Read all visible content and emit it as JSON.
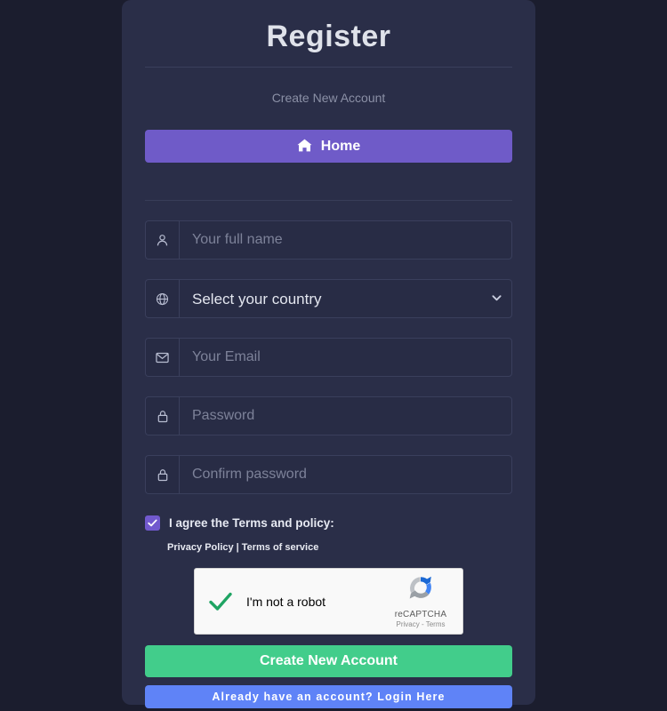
{
  "card": {
    "title": "Register",
    "subtitle": "Create New Account"
  },
  "home_button": {
    "label": "Home",
    "icon": "home-icon",
    "color": "#6f5bc8"
  },
  "fields": [
    {
      "name": "full-name",
      "icon": "person-icon",
      "placeholder": "Your full name",
      "value": ""
    },
    {
      "name": "country",
      "icon": "globe-icon",
      "selected": "Select your country",
      "chevron": "chevron-down-icon"
    },
    {
      "name": "email",
      "icon": "envelope-icon",
      "placeholder": "Your Email",
      "value": ""
    },
    {
      "name": "password",
      "icon": "lock-icon",
      "placeholder": "Password",
      "value": ""
    },
    {
      "name": "confirm-password",
      "icon": "lock-icon",
      "placeholder": "Confirm password",
      "value": ""
    }
  ],
  "terms": {
    "checked": true,
    "checkbox_icon": "checkmark-icon",
    "checkbox_color": "#7159ce",
    "label": "I agree the Terms and policy:",
    "privacy_link": "Privacy Policy",
    "separator": "|",
    "terms_link": "Terms of service"
  },
  "recaptcha": {
    "label": "I'm not a robot",
    "checked": true,
    "check_icon": "green-checkmark-icon",
    "check_color": "#1fa463",
    "brand": "reCAPTCHA",
    "legal": "Privacy - Terms",
    "logo_icon": "recaptcha-logo-icon"
  },
  "submit_button": {
    "label": "Create New Account",
    "color": "#42cd8b"
  },
  "login_button": {
    "label": "Already have an account? Login Here",
    "color": "#5f83f7"
  }
}
